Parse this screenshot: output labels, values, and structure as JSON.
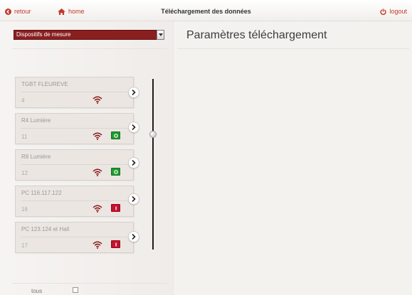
{
  "topbar": {
    "back_label": "retour",
    "home_label": "home",
    "title": "Téléchargement des données",
    "logout_label": "logout",
    "accent_color": "#c0392b"
  },
  "left": {
    "select_value": "Dispositifs de mesure",
    "all_label": "tous",
    "devices": [
      {
        "name": "TGBT FLEUREVE",
        "number": "4",
        "signal_icon": "wifi-icon",
        "status": "none"
      },
      {
        "name": "R4 Lumière",
        "number": "11",
        "signal_icon": "wifi-icon",
        "status": "on"
      },
      {
        "name": "R8 Lumière",
        "number": "12",
        "signal_icon": "wifi-icon",
        "status": "on"
      },
      {
        "name": "PC 116.117.122",
        "number": "16",
        "signal_icon": "wifi-icon",
        "status": "off"
      },
      {
        "name": "PC 123.124 et Hall",
        "number": "17",
        "signal_icon": "wifi-icon",
        "status": "off"
      }
    ],
    "status_colors": {
      "on": "#1e9b2f",
      "off": "#c8102e"
    }
  },
  "right": {
    "title": "Paramètres téléchargement"
  }
}
